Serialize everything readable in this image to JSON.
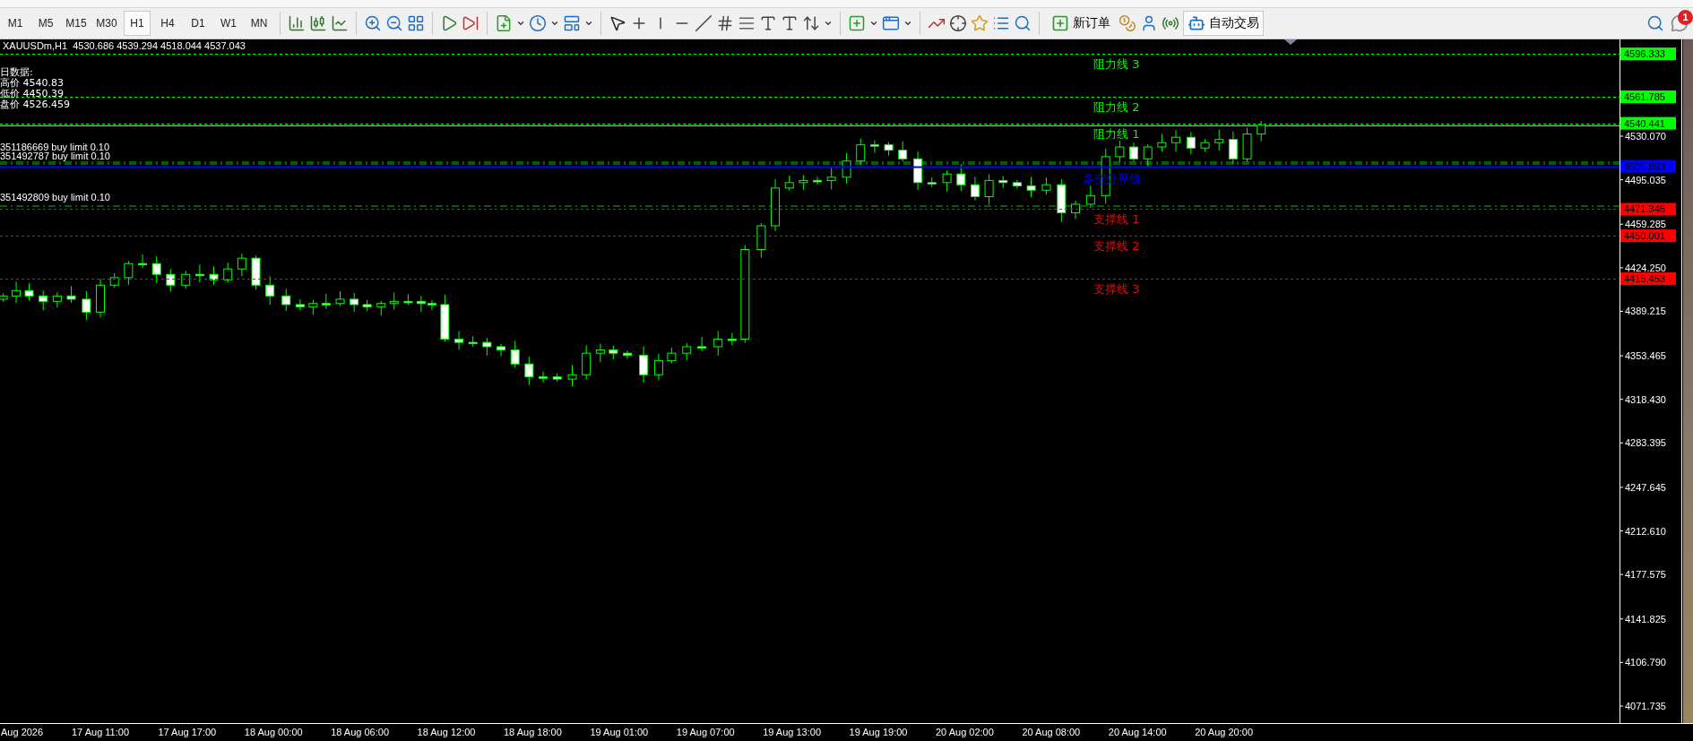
{
  "toolbar": {
    "timeframes": [
      {
        "label": "M1",
        "selected": false
      },
      {
        "label": "M5",
        "selected": false
      },
      {
        "label": "M15",
        "selected": false
      },
      {
        "label": "M30",
        "selected": false
      },
      {
        "label": "H1",
        "selected": true
      },
      {
        "label": "H4",
        "selected": false
      },
      {
        "label": "D1",
        "selected": false
      },
      {
        "label": "W1",
        "selected": false
      },
      {
        "label": "MN",
        "selected": false
      }
    ],
    "new_order": "新订单",
    "auto_trading": "自动交易",
    "notification_count": "1"
  },
  "chart": {
    "header": "XAUUSDm,H1  4530.686 4539.294 4518.044 4537.043",
    "daily": {
      "title": "日数据:",
      "rows": [
        "高价 4540.83",
        "低价 4450.39",
        "盘价 4526.459"
      ]
    },
    "orders": [
      "351186669 buy limit 0.10",
      "351492787 buy limit 0.10",
      "351492809 buy limit 0.10"
    ],
    "levels": [
      {
        "label": "阻力线 3",
        "price": "4596.333",
        "color": "#00ff00",
        "kind": "dashed"
      },
      {
        "label": "阻力线 2",
        "price": "4561.785",
        "color": "#00ff00",
        "kind": "dashed"
      },
      {
        "label": "阻力线 1",
        "price": "4540.441",
        "color": "#00ff00",
        "kind": "dashed"
      },
      {
        "label": "多空分界线",
        "price": "4505.893",
        "color": "#0000ff",
        "kind": "solid"
      },
      {
        "label": "支撑线 1",
        "price": "4471.345",
        "color": "#ff0000",
        "kind": "dashed"
      },
      {
        "label": "支撑线 2",
        "price": "4450.001",
        "color": "#ff0000",
        "kind": "dashed"
      },
      {
        "label": "支撑线 3",
        "price": "4415.453",
        "color": "#ff0000",
        "kind": "dashed"
      }
    ],
    "price_axis": [
      "4530.070",
      "4495.035",
      "4459.285",
      "4424.250",
      "4389.215",
      "4353.465",
      "4318.430",
      "4283.395",
      "4247.645",
      "4212.610",
      "4177.575",
      "4141.825",
      "4106.790",
      "4071.735"
    ],
    "time_axis": [
      "Aug 2026",
      "17 Aug 11:00",
      "17 Aug 17:00",
      "18 Aug 00:00",
      "18 Aug 06:00",
      "18 Aug 12:00",
      "18 Aug 18:00",
      "19 Aug 01:00",
      "19 Aug 07:00",
      "19 Aug 13:00",
      "19 Aug 19:00",
      "20 Aug 02:00",
      "20 Aug 08:00",
      "20 Aug 14:00",
      "20 Aug 20:00"
    ]
  }
}
